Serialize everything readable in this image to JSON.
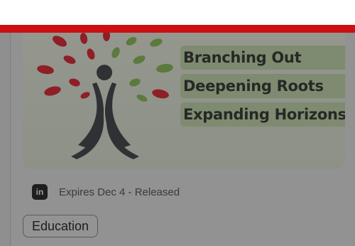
{
  "banner": {
    "lines": [
      "Branching Out",
      "Deepening Roots",
      "Expanding Horizons"
    ]
  },
  "course": {
    "provider_icon": "linkedin-icon",
    "provider_badge": "in",
    "meta": "Expires Dec 4 - Released"
  },
  "tags": [
    "Education"
  ],
  "colors": {
    "accent_bar": "#cc0f12",
    "overlay": "#8f8f8f"
  }
}
